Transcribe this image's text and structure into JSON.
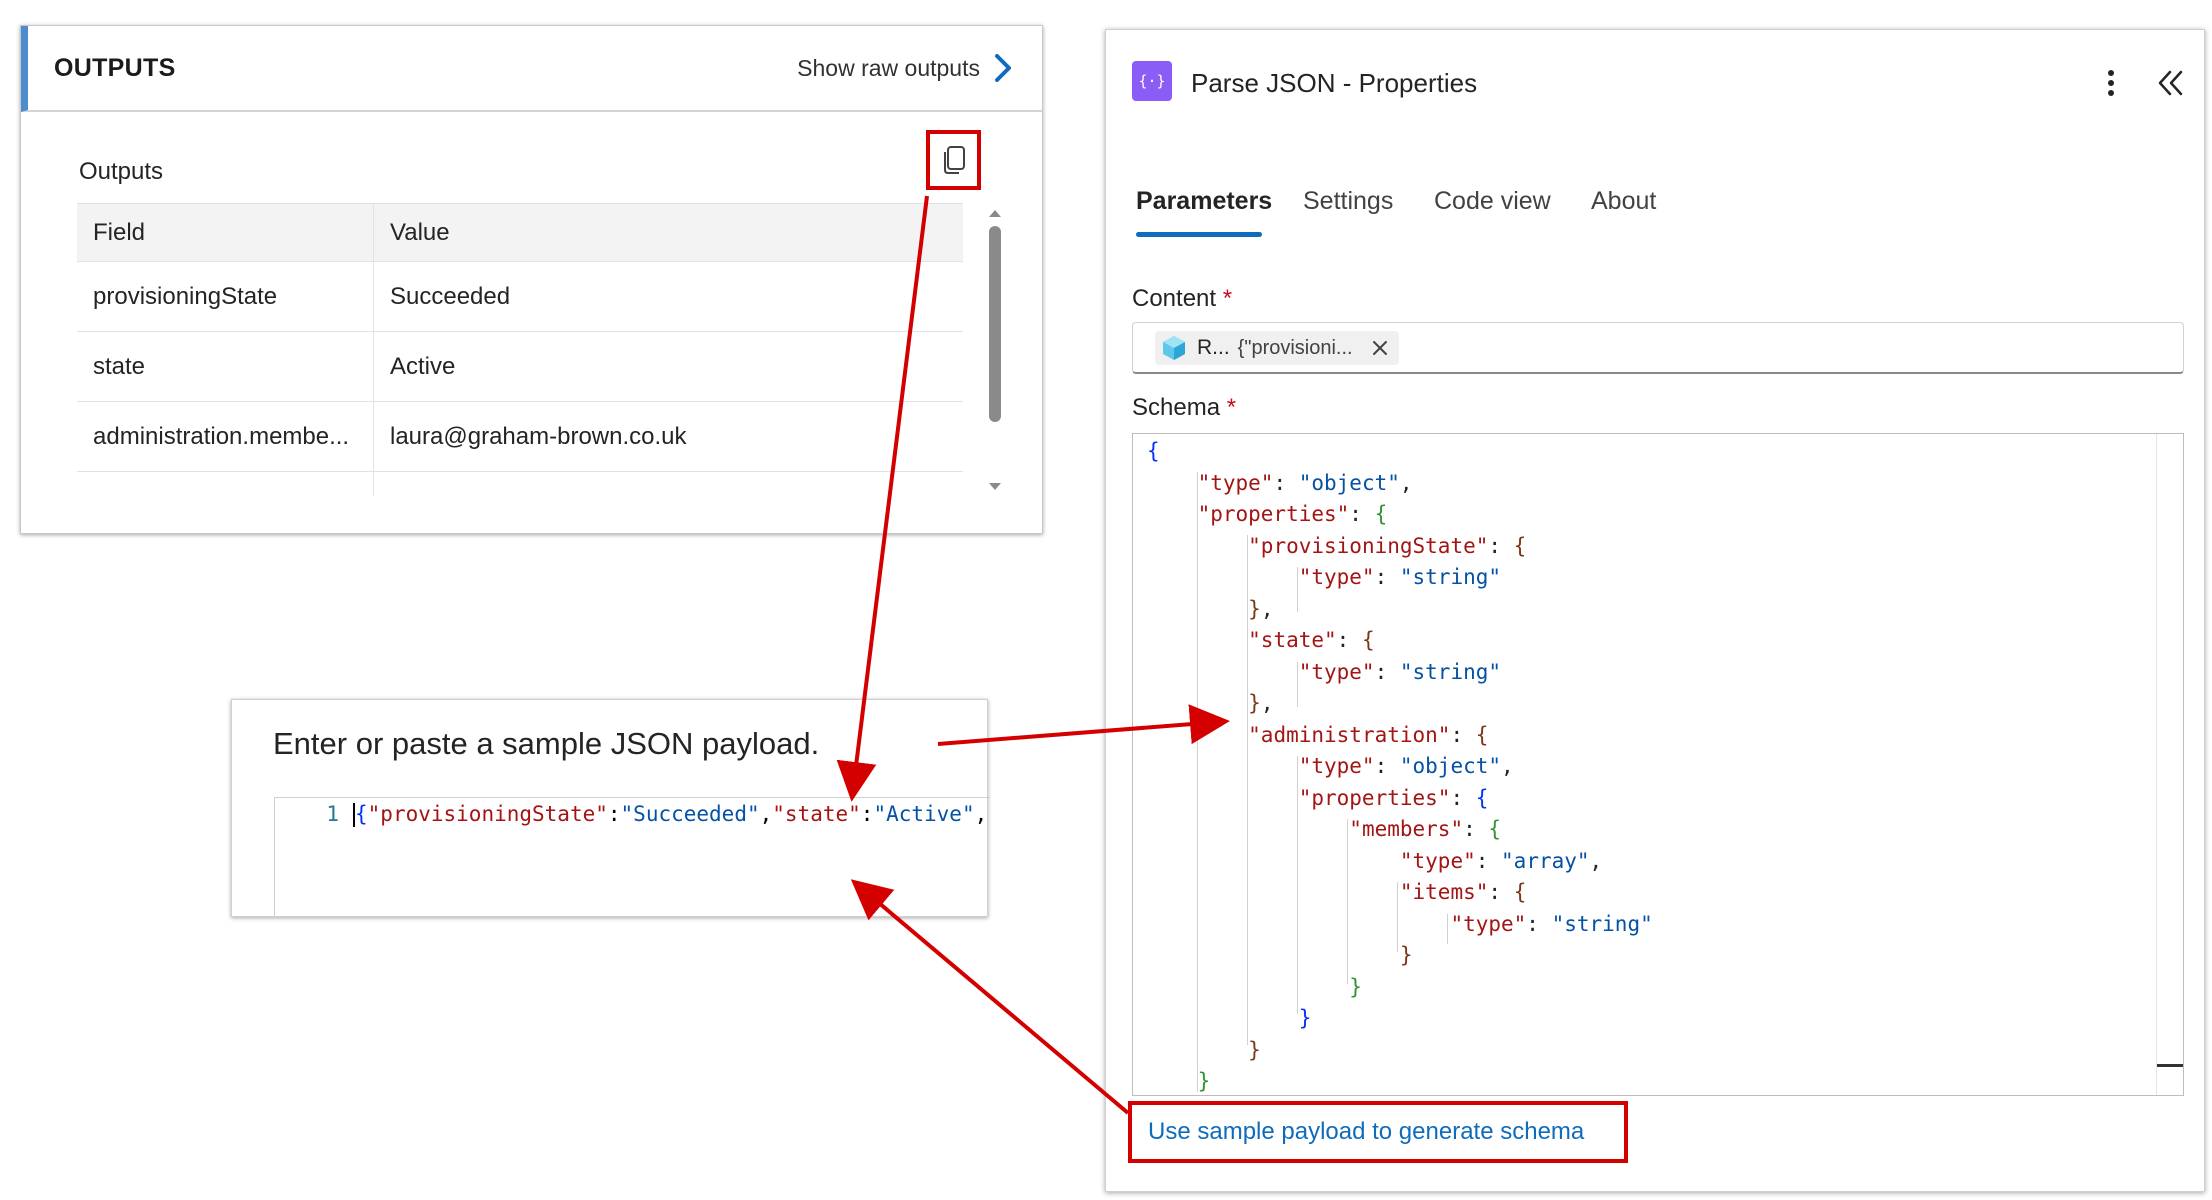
{
  "outputs": {
    "title": "OUTPUTS",
    "show_raw_label": "Show raw outputs",
    "section_label": "Outputs",
    "table": {
      "headers": [
        "Field",
        "Value"
      ],
      "rows": [
        [
          "provisioningState",
          "Succeeded"
        ],
        [
          "state",
          "Active"
        ],
        [
          "administration.membe...",
          "laura@graham-brown.co.uk"
        ]
      ]
    }
  },
  "payload": {
    "title": "Enter or paste a sample JSON payload.",
    "line_number": "1",
    "line_text_open": "{",
    "k1": "\"provisioningState\"",
    "sep1": ":",
    "v1": "\"Succeeded\"",
    "comma1": ",",
    "k2": "\"state\"",
    "sep2": ":",
    "v2": "\"Active\"",
    "tail": ",'"
  },
  "parse_panel": {
    "icon_glyph": "{·}",
    "title": "Parse JSON - Properties",
    "tabs": [
      "Parameters",
      "Settings",
      "Code view",
      "About"
    ],
    "content_label": "Content",
    "schema_label": "Schema",
    "required_mark": "*",
    "token_name": "R...",
    "token_value": "{\"provisioni...",
    "generate_link": "Use sample payload to generate schema"
  },
  "colors": {
    "accent": "#0f6cbd",
    "highlight_red": "#d40000",
    "parse_icon": "#8b5cf6"
  }
}
